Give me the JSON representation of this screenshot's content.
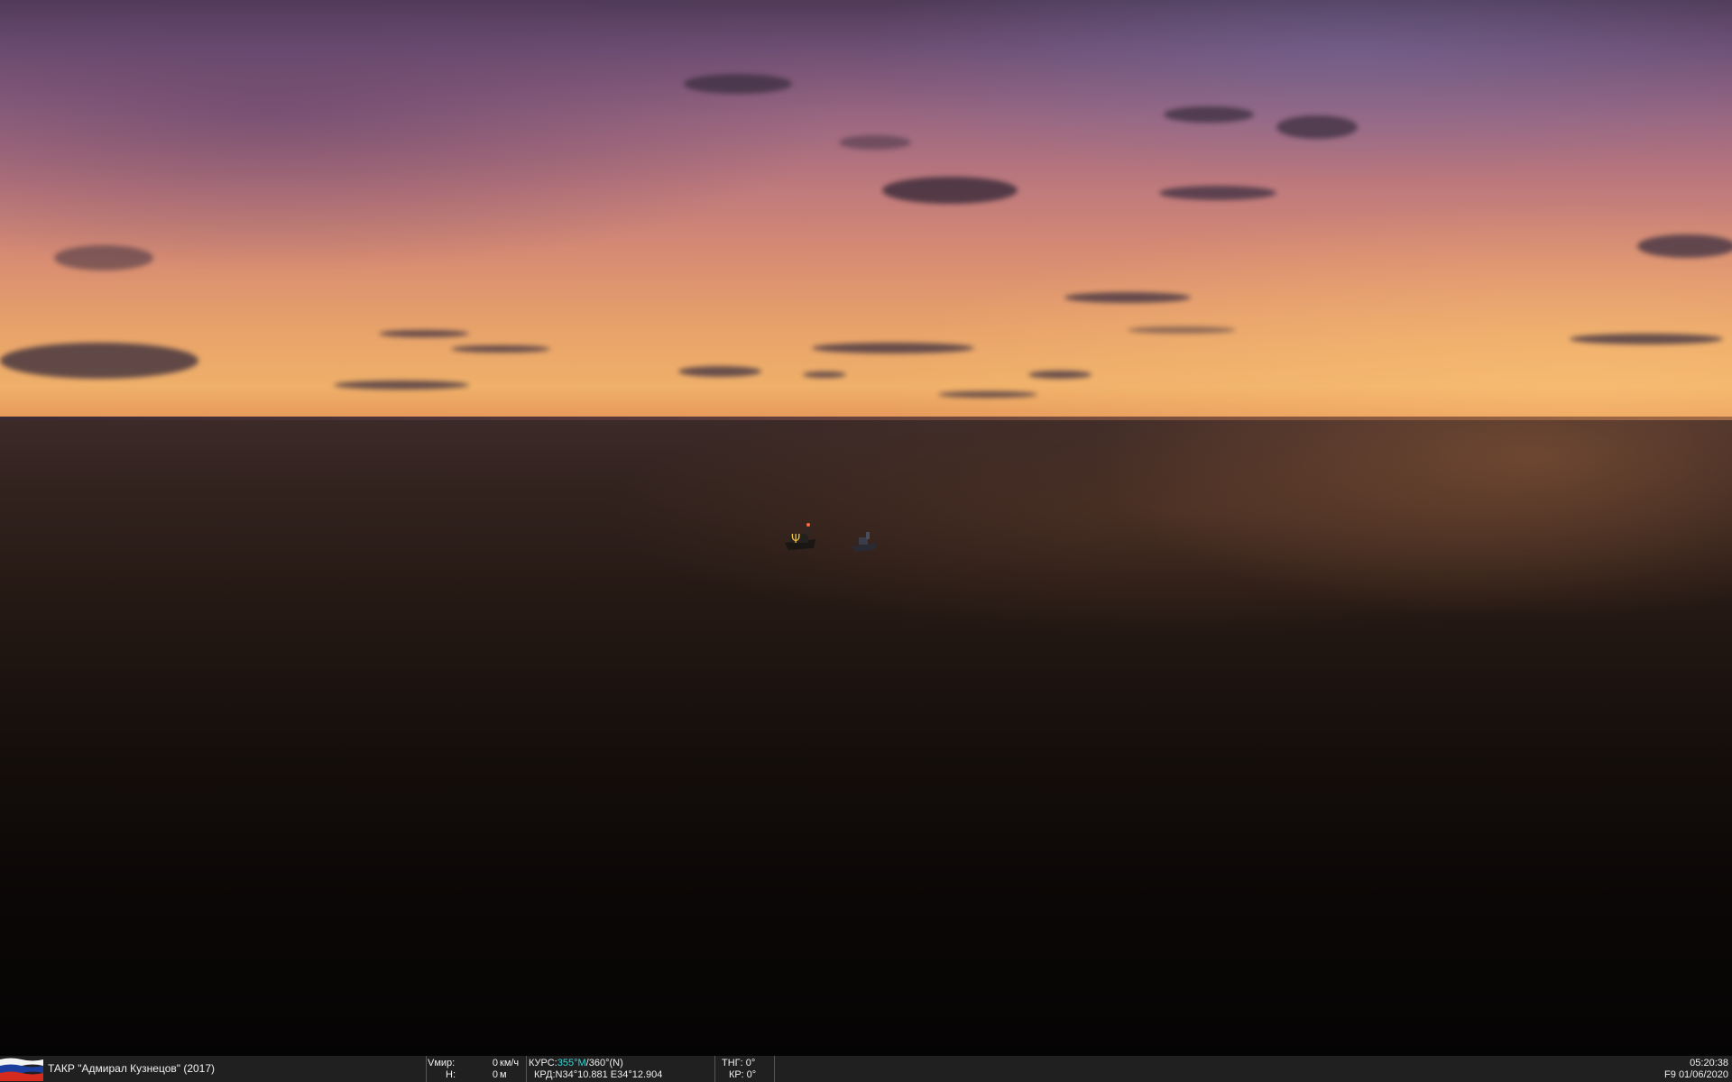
{
  "statusbar": {
    "unit_name": "ТАКР \"Адмирал Кузнецов\" (2017)",
    "speed_label": "Vмир:",
    "speed_value": "0",
    "speed_unit": "км/ч",
    "alt_label": "H:",
    "alt_value": "0",
    "alt_unit": "м",
    "course_label": "КУРС:",
    "course_magnetic": "355°M",
    "course_true": "/360°(N)",
    "coord_label": "КРД:",
    "coord_value": "N34°10.881 E34°12.904",
    "pitch_label": "ТНГ:",
    "pitch_value": "0°",
    "roll_label": "КР:",
    "roll_value": "0°",
    "time": "05:20:38",
    "view_key": "F9",
    "date": "01/06/2020"
  },
  "flag_colors": [
    "#ffffff",
    "#1c3f9e",
    "#d52b1e"
  ]
}
